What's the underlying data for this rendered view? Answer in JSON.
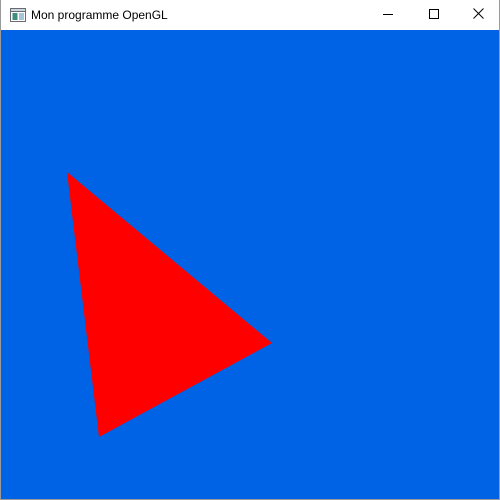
{
  "window": {
    "title": "Mon programme OpenGL",
    "app_icon": "application-window-icon",
    "buttons": {
      "minimize_icon": "minimize-icon",
      "maximize_icon": "maximize-icon",
      "close_icon": "close-icon"
    }
  },
  "scene": {
    "clear_color": "#0063e5",
    "triangle": {
      "shape": "triangle",
      "color": "#ff0000"
    }
  }
}
